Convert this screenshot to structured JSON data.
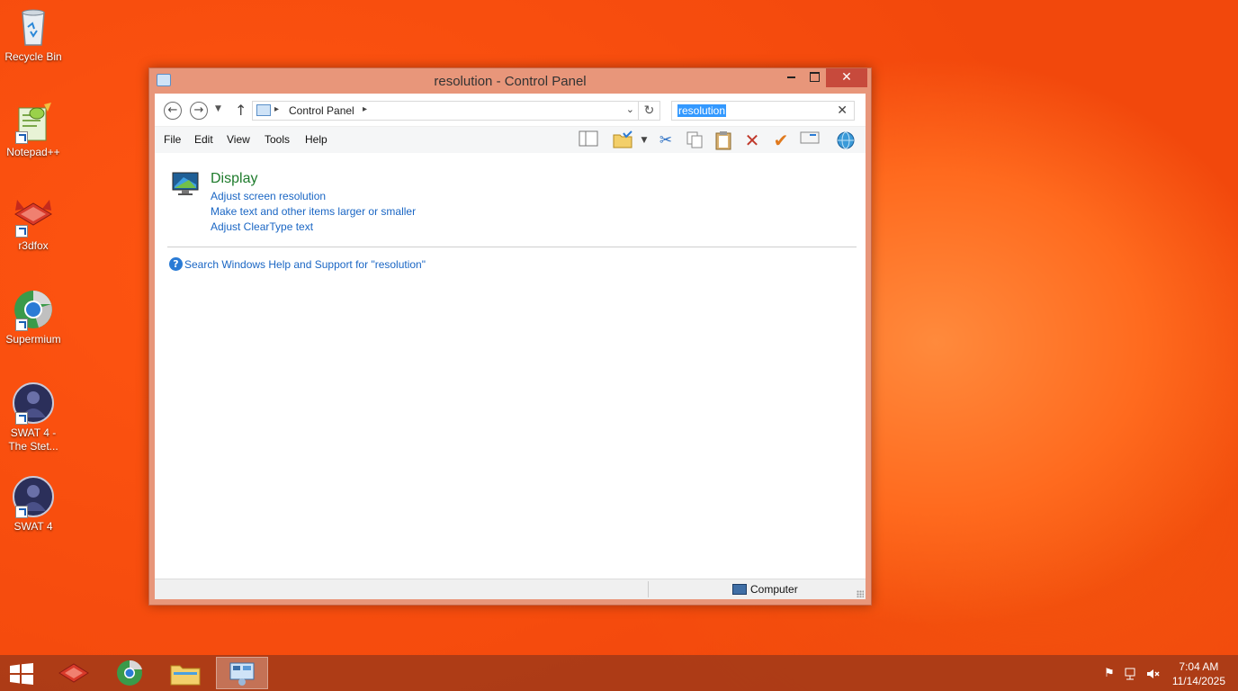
{
  "desktop": {
    "icons": [
      {
        "label": "Recycle Bin",
        "icon": "recycle-bin-icon"
      },
      {
        "label": "Notepad++",
        "icon": "notepad-plus-plus-icon"
      },
      {
        "label": "r3dfox",
        "icon": "r3dfox-icon"
      },
      {
        "label": "Supermium",
        "icon": "supermium-icon"
      },
      {
        "label": "SWAT 4 -",
        "label2": "The Stet...",
        "icon": "swat4-stetchkov-icon"
      },
      {
        "label": "SWAT 4",
        "icon": "swat4-icon"
      }
    ]
  },
  "window": {
    "title": "resolution - Control Panel",
    "address": {
      "crumb": "Control Panel"
    },
    "search": {
      "value": "resolution"
    },
    "menu": [
      "File",
      "Edit",
      "View",
      "Tools",
      "Help"
    ],
    "toolbar": [
      "layout-icon",
      "folder-options-icon",
      "cut-icon",
      "copy-icon",
      "paste-icon",
      "delete-icon",
      "properties-check-icon",
      "rename-icon",
      "globe-icon"
    ],
    "results": {
      "category": "Display",
      "links": [
        "Adjust screen resolution",
        "Make text and other items larger or smaller",
        "Adjust ClearType text"
      ]
    },
    "help_link": "Search Windows Help and Support for \"resolution\"",
    "status": {
      "zone": "Computer"
    }
  },
  "taskbar": {
    "pinned": [
      "r3dfox-icon",
      "supermium-icon",
      "file-explorer-icon",
      "control-panel-icon"
    ],
    "active_index": 3,
    "clock": {
      "time": "7:04 AM",
      "date": "11/14/2025"
    }
  },
  "colors": {
    "accent": "#f04a0d",
    "link": "#1a66c4",
    "category": "#1e7b2c",
    "selection": "#3399ff"
  }
}
